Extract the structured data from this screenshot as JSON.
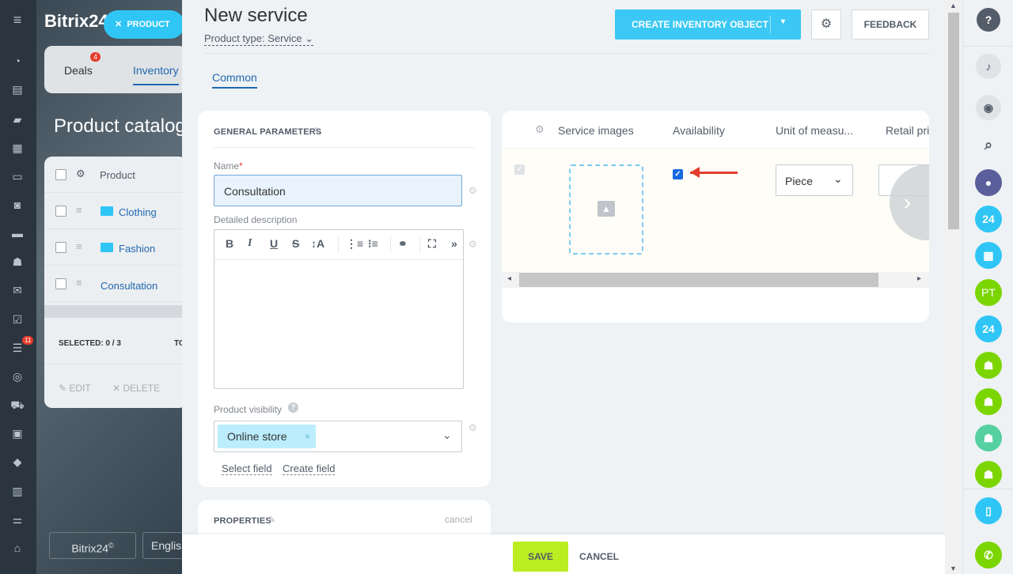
{
  "app": {
    "name": "Bitrix24",
    "version_glyph": "2"
  },
  "left_nav": {
    "badge_count": "11"
  },
  "background_page": {
    "product_chip": "PRODUCT",
    "tabs": [
      {
        "label": "Deals",
        "badge": "4"
      },
      {
        "label": "Inventory"
      }
    ],
    "title": "Product catalog",
    "list_header": "Product",
    "rows": [
      "Clothing",
      "Fashion",
      "Consultation"
    ],
    "selected": "SELECTED: 0 / 3",
    "selected_extra": "TO",
    "edit": "EDIT",
    "delete": "DELETE",
    "footer_brand": "Bitrix24",
    "footer_lang": "English"
  },
  "slider": {
    "title": "New service",
    "product_type": "Product type: Service",
    "create_button": "CREATE INVENTORY OBJECT",
    "feedback_button": "FEEDBACK",
    "tab": "Common",
    "general": {
      "title": "GENERAL PARAMETERS",
      "name_label": "Name",
      "name_required": "*",
      "name_value": "Consultation",
      "description_label": "Detailed description",
      "visibility_label": "Product visibility",
      "visibility_tag": "Online store",
      "select_field": "Select field",
      "create_field": "Create field"
    },
    "properties": {
      "title": "PROPERTIES",
      "cancel": "cancel"
    },
    "grid": {
      "headers": [
        "Service images",
        "Availability",
        "Unit of measu...",
        "Retail pri"
      ],
      "unit_value": "Piece",
      "availability_checked": true
    },
    "save": "SAVE",
    "cancel": "CANCEL"
  },
  "right_bar": {
    "avatar_initials": "PT",
    "b24_label": "24",
    "colors": {
      "b24": "#2fc6f6",
      "green": "#7bd500",
      "help": "#535c69"
    }
  }
}
